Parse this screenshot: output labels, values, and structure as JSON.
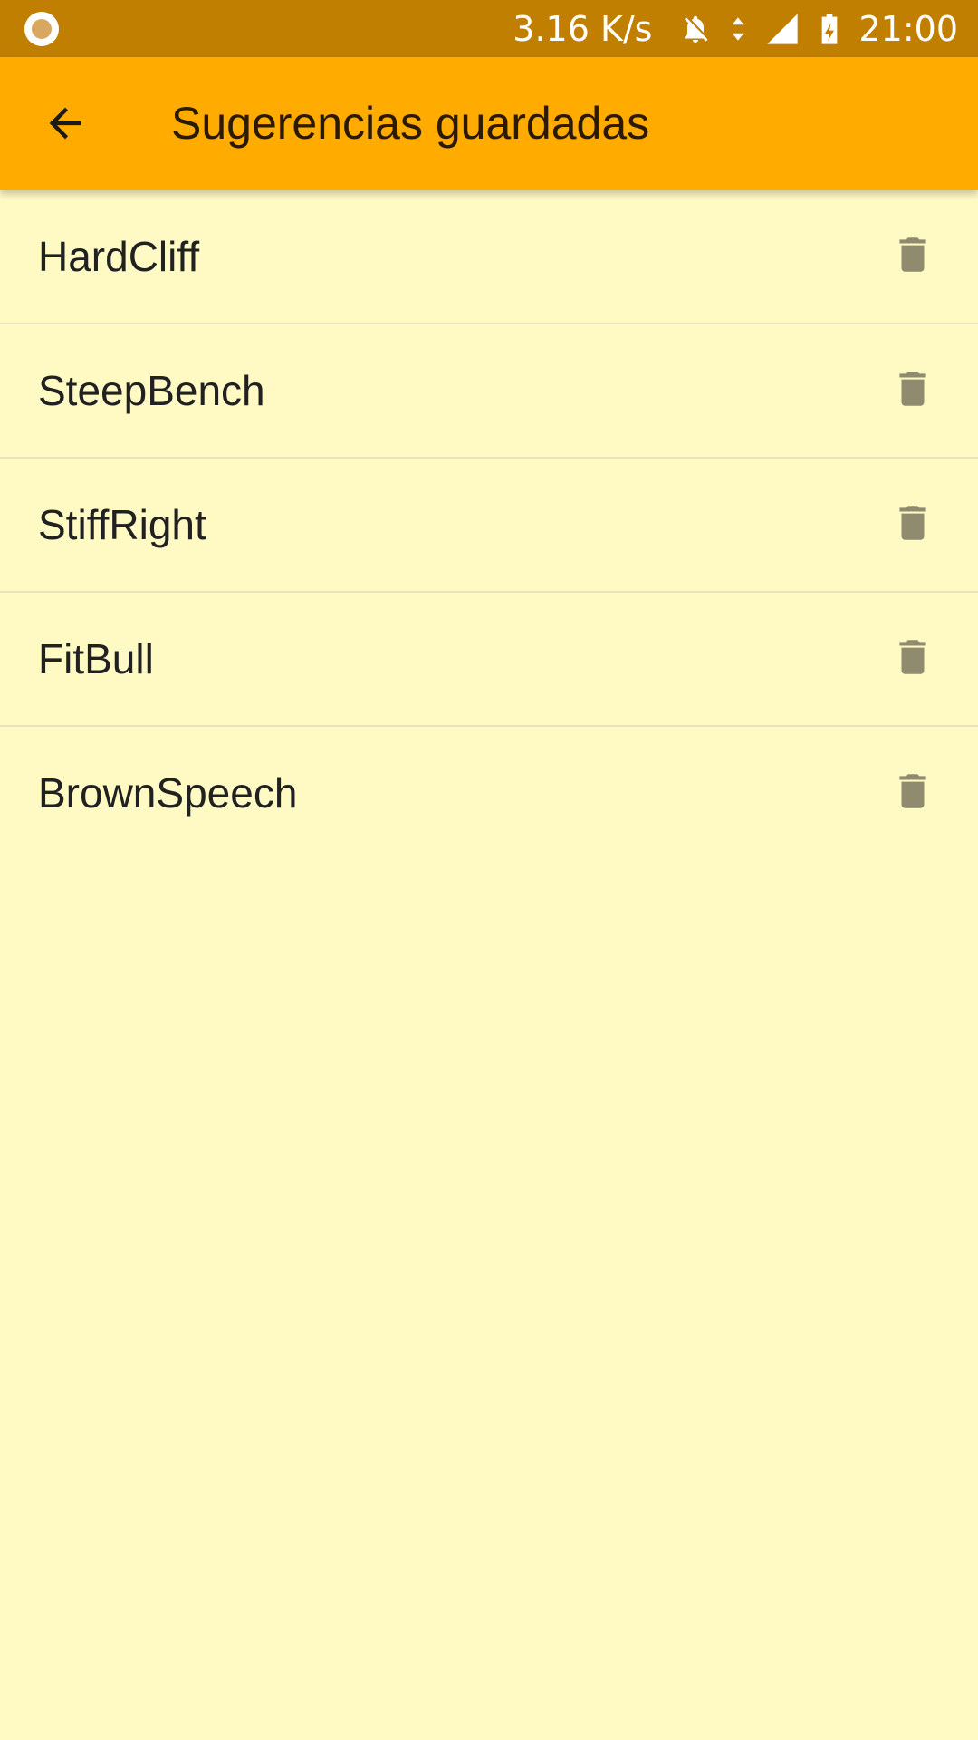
{
  "status_bar": {
    "net_speed": "3.16 K/s",
    "time": "21:00",
    "icons": [
      "notification-dot-icon",
      "bell-off-icon",
      "data-arrows-icon",
      "signal-icon",
      "battery-charging-icon"
    ]
  },
  "app_bar": {
    "title": "Sugerencias guardadas",
    "back_icon": "arrow-back-icon"
  },
  "saved_suggestions": [
    {
      "label": "HardCliff",
      "action_icon": "delete-icon"
    },
    {
      "label": "SteepBench",
      "action_icon": "delete-icon"
    },
    {
      "label": "StiffRight",
      "action_icon": "delete-icon"
    },
    {
      "label": "FitBull",
      "action_icon": "delete-icon"
    },
    {
      "label": "BrownSpeech",
      "action_icon": "delete-icon"
    }
  ],
  "colors": {
    "status_bar": "#C17F00",
    "app_bar": "#FFAB00",
    "background": "#FFF9C4",
    "delete_icon": "#908B6E",
    "divider": "#E8E3BC"
  }
}
